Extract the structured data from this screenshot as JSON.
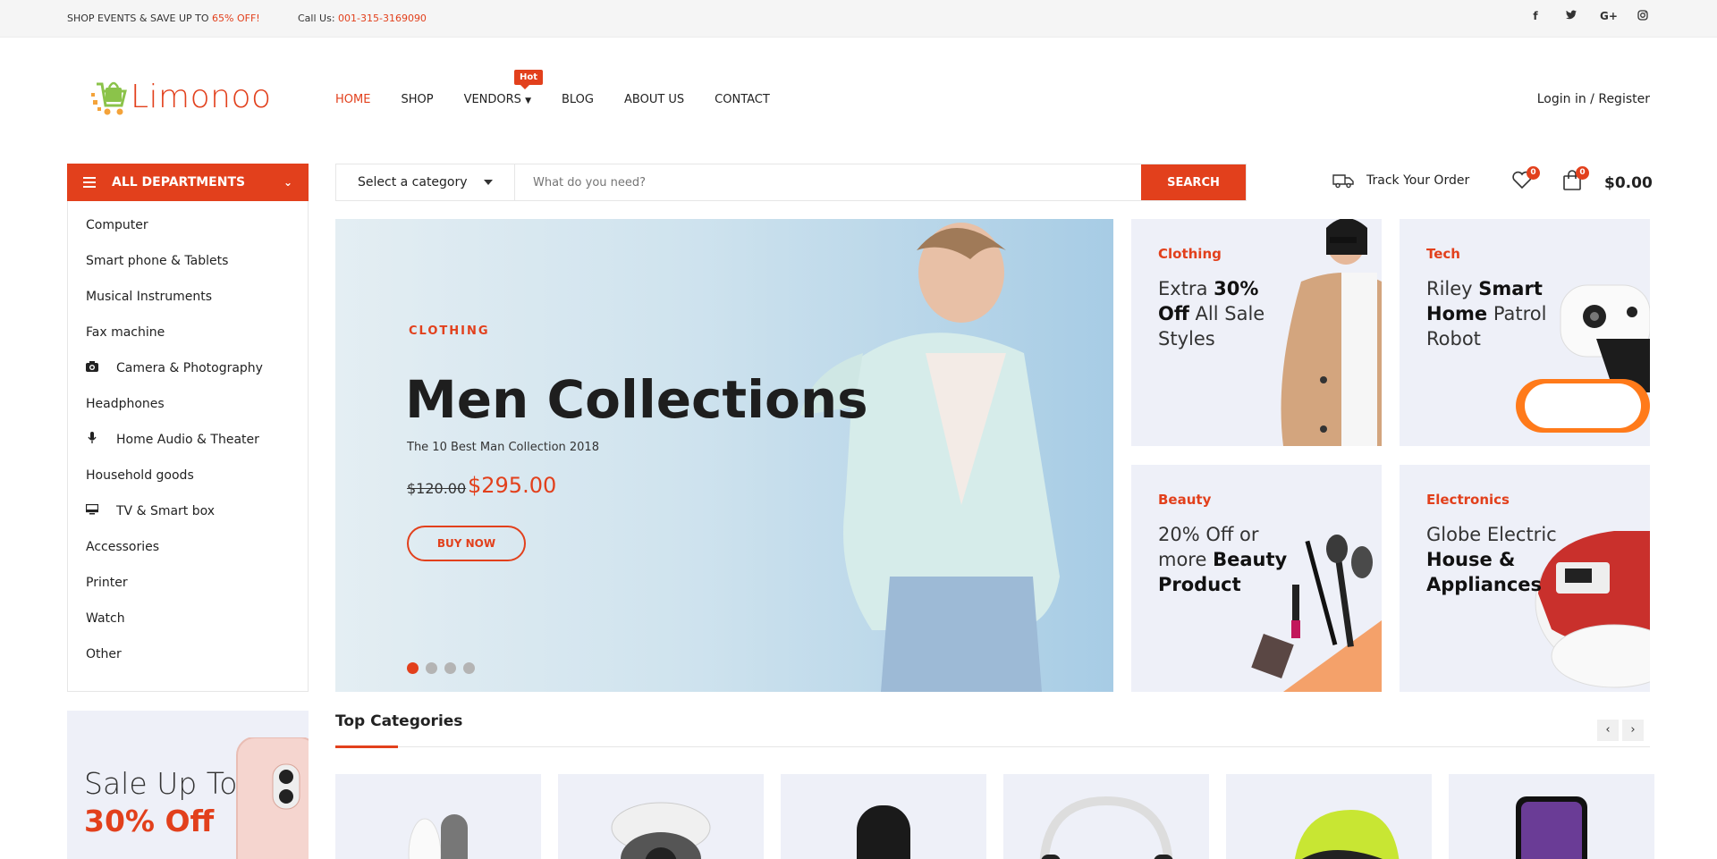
{
  "topbar": {
    "promo_prefix": "SHOP EVENTS & SAVE UP TO ",
    "promo_value": "65% OFF!",
    "call_prefix": "Call Us: ",
    "call_number": "001-315-3169090",
    "social": [
      "f",
      "t",
      "G+",
      "ig"
    ]
  },
  "header": {
    "logo_text": "Limonoo",
    "nav": [
      "HOME",
      "SHOP",
      "VENDORS",
      "BLOG",
      "ABOUT US",
      "CONTACT"
    ],
    "hot_badge": "Hot",
    "login": "Login in / Register"
  },
  "departments": {
    "title": "ALL DEPARTMENTS",
    "items": [
      {
        "label": "Computer",
        "icon": ""
      },
      {
        "label": "Smart phone & Tablets",
        "icon": ""
      },
      {
        "label": "Musical Instruments",
        "icon": ""
      },
      {
        "label": "Fax machine",
        "icon": ""
      },
      {
        "label": "Camera & Photography",
        "icon": "camera-icon"
      },
      {
        "label": "Headphones",
        "icon": ""
      },
      {
        "label": "Home Audio & Theater",
        "icon": "microphone-icon"
      },
      {
        "label": "Household goods",
        "icon": ""
      },
      {
        "label": "TV & Smart box",
        "icon": "monitor-icon"
      },
      {
        "label": "Accessories",
        "icon": ""
      },
      {
        "label": "Printer",
        "icon": ""
      },
      {
        "label": "Watch",
        "icon": ""
      },
      {
        "label": "Other",
        "icon": ""
      }
    ]
  },
  "search": {
    "category": "Select a category",
    "placeholder": "What do you need?",
    "button": "SEARCH"
  },
  "tools": {
    "track": "Track Your Order",
    "wishlist_count": "0",
    "cart_count": "0",
    "cart_total": "$0.00"
  },
  "hero": {
    "tag": "CLOTHING",
    "title": "Men Collections",
    "subtitle": "The 10 Best Man Collection 2018",
    "old_price": "$120.00",
    "new_price": "$295.00",
    "button": "BUY NOW",
    "slides": 4,
    "active_slide": 1
  },
  "banners": [
    {
      "tag": "Clothing",
      "pre": "Extra ",
      "bold": "30% Off",
      "post": " All Sale Styles"
    },
    {
      "tag": "Tech",
      "pre": "Riley ",
      "bold": "Smart Home",
      "post": " Patrol Robot"
    },
    {
      "tag": "Beauty",
      "pre": "20% Off or more ",
      "bold": "Beauty Product",
      "post": ""
    },
    {
      "tag": "Electronics",
      "pre": "Globe Electric ",
      "bold": "House & Appliances",
      "post": ""
    }
  ],
  "top_categories": {
    "title": "Top Categories",
    "prev": "‹",
    "next": "›"
  },
  "sale_banner": {
    "line1": "Sale Up To",
    "line2": "30% Off"
  },
  "colors": {
    "accent": "#e2401c",
    "banner_bg": "#eef0f8"
  }
}
